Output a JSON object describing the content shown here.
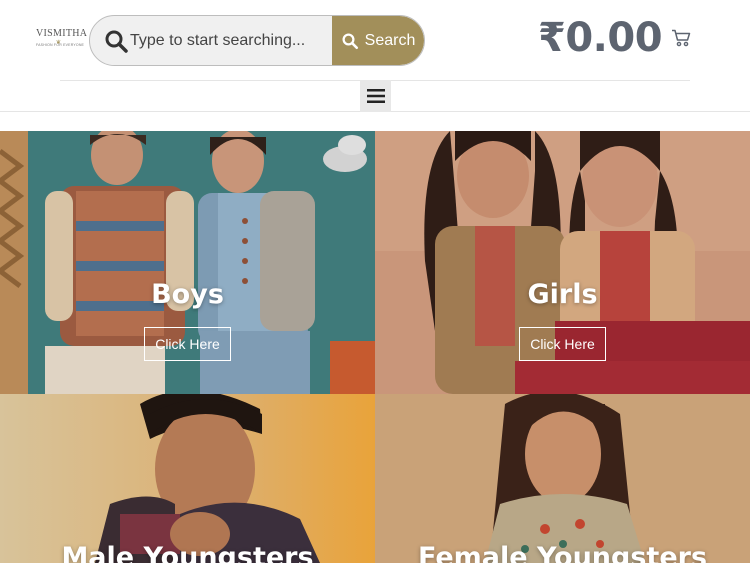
{
  "brand": {
    "name": "VISMITHA",
    "tagline": "FASHION FOR EVERYONE"
  },
  "search": {
    "placeholder": "Type to start searching...",
    "button_label": "Search"
  },
  "cart": {
    "total": "₹0.00"
  },
  "colors": {
    "accent": "#a28f5a",
    "price": "#5d6470"
  },
  "categories": [
    {
      "title": "Boys",
      "button": "Click Here"
    },
    {
      "title": "Girls",
      "button": "Click Here"
    },
    {
      "title": "Male Youngsters"
    },
    {
      "title": "Female Youngsters"
    }
  ]
}
